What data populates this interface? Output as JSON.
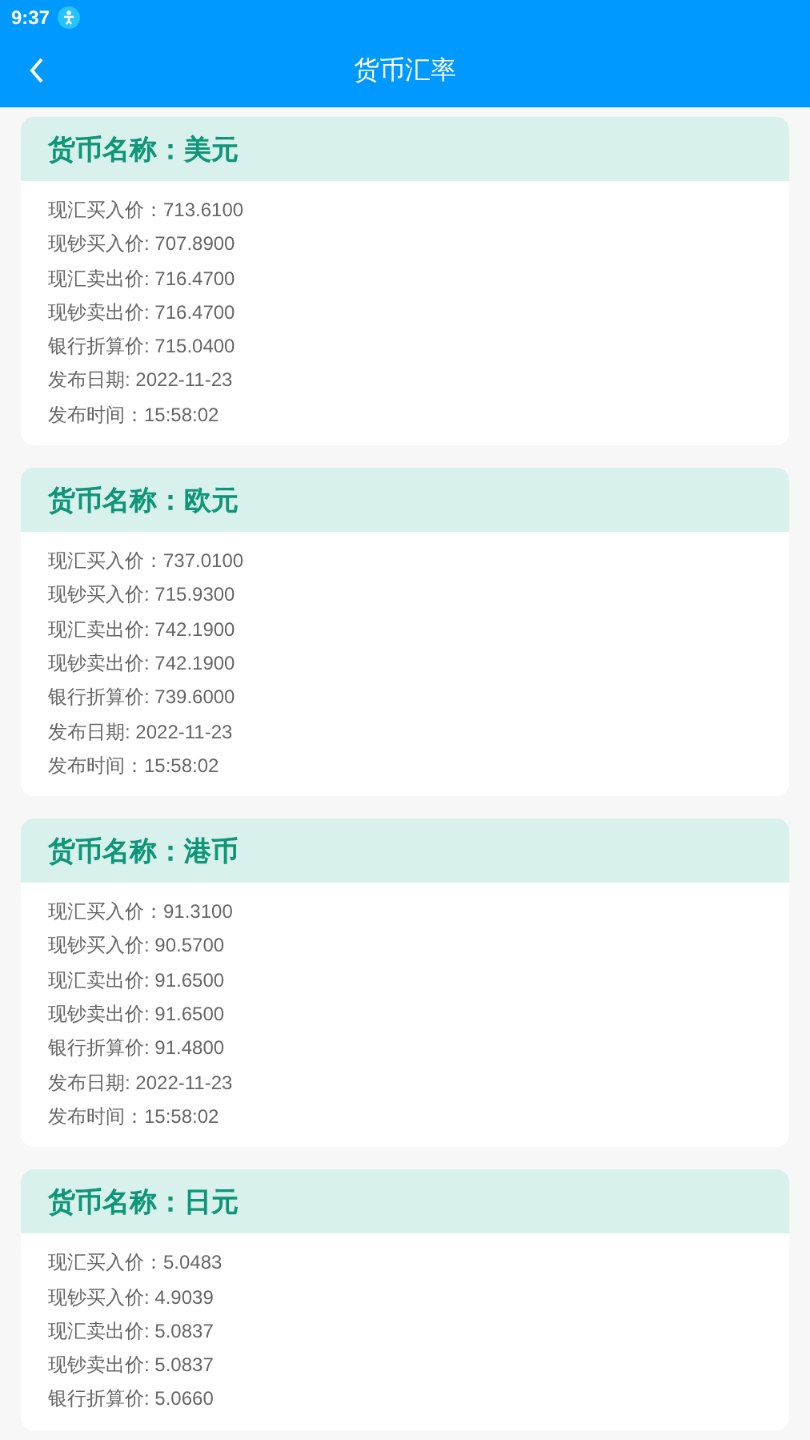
{
  "status_bar": {
    "time": "9:37"
  },
  "header": {
    "title": "货币汇率"
  },
  "cards": [
    {
      "title": "货币名称：美元",
      "lines": [
        "现汇买入价：713.6100",
        "现钞买入价: 707.8900",
        "现汇卖出价: 716.4700",
        "现钞卖出价: 716.4700",
        "银行折算价: 715.0400",
        "发布日期: 2022-11-23",
        "发布时间：15:58:02"
      ]
    },
    {
      "title": "货币名称：欧元",
      "lines": [
        "现汇买入价：737.0100",
        "现钞买入价: 715.9300",
        "现汇卖出价: 742.1900",
        "现钞卖出价: 742.1900",
        "银行折算价: 739.6000",
        "发布日期: 2022-11-23",
        "发布时间：15:58:02"
      ]
    },
    {
      "title": "货币名称：港币",
      "lines": [
        "现汇买入价：91.3100",
        "现钞买入价: 90.5700",
        "现汇卖出价: 91.6500",
        "现钞卖出价: 91.6500",
        "银行折算价: 91.4800",
        "发布日期: 2022-11-23",
        "发布时间：15:58:02"
      ]
    },
    {
      "title": "货币名称：日元",
      "lines": [
        "现汇买入价：5.0483",
        "现钞买入价: 4.9039",
        "现汇卖出价: 5.0837",
        "现钞卖出价: 5.0837",
        "银行折算价: 5.0660"
      ]
    }
  ]
}
